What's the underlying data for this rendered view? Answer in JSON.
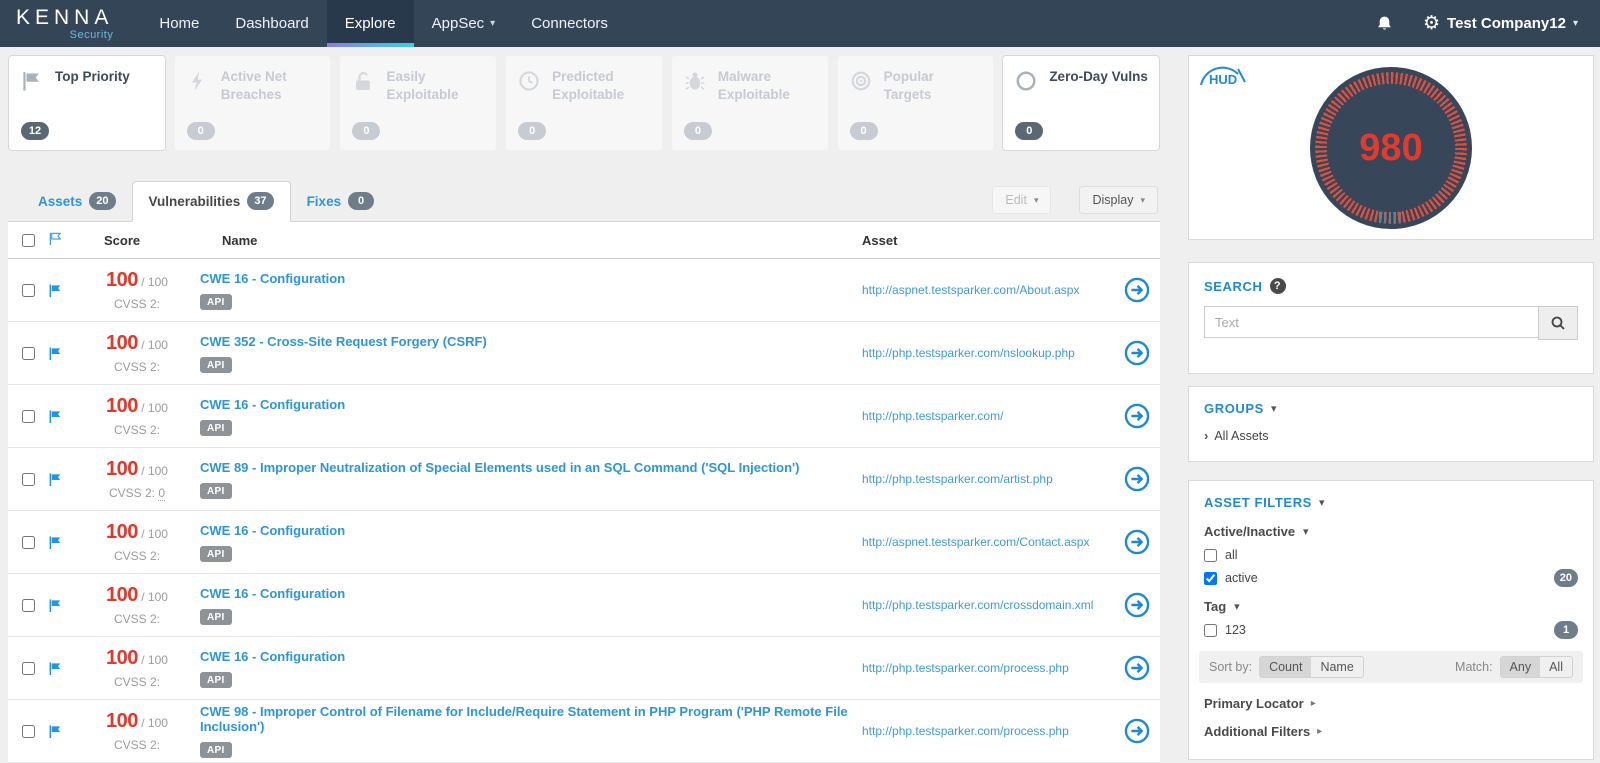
{
  "nav": {
    "brand_title": "KENNA",
    "brand_subtitle": "Security",
    "items": [
      {
        "label": "Home",
        "active": false
      },
      {
        "label": "Dashboard",
        "active": false
      },
      {
        "label": "Explore",
        "active": true
      },
      {
        "label": "AppSec",
        "active": false,
        "dropdown": true
      },
      {
        "label": "Connectors",
        "active": false
      }
    ],
    "account_label": "Test Company12"
  },
  "risk_meters": [
    {
      "label": "Top Priority",
      "count": "12",
      "icon": "flag-icon",
      "active": true
    },
    {
      "label": "Active Net Breaches",
      "count": "0",
      "icon": "bolt-icon",
      "active": false
    },
    {
      "label": "Easily Exploitable",
      "count": "0",
      "icon": "unlock-icon",
      "active": false
    },
    {
      "label": "Predicted Exploitable",
      "count": "0",
      "icon": "clock-icon",
      "active": false
    },
    {
      "label": "Malware Exploitable",
      "count": "0",
      "icon": "bug-icon",
      "active": false
    },
    {
      "label": "Popular Targets",
      "count": "0",
      "icon": "target-icon",
      "active": false
    },
    {
      "label": "Zero-Day Vulns",
      "count": "0",
      "icon": "circle-icon",
      "active": true
    }
  ],
  "tabs": [
    {
      "label": "Assets",
      "count": "20",
      "active": false
    },
    {
      "label": "Vulnerabilities",
      "count": "37",
      "active": true
    },
    {
      "label": "Fixes",
      "count": "0",
      "active": false
    }
  ],
  "toolbar": {
    "edit_label": "Edit",
    "display_label": "Display"
  },
  "table": {
    "headers": {
      "score": "Score",
      "name": "Name",
      "asset": "Asset"
    },
    "rows": [
      {
        "score": "100",
        "score_max": "/ 100",
        "cvss_label": "CVSS 2:",
        "cvss_value": "",
        "name": "CWE 16 - Configuration",
        "badge": "API",
        "asset": "http://aspnet.testsparker.com/About.aspx"
      },
      {
        "score": "100",
        "score_max": "/ 100",
        "cvss_label": "CVSS 2:",
        "cvss_value": "",
        "name": "CWE 352 - Cross-Site Request Forgery (CSRF)",
        "badge": "API",
        "asset": "http://php.testsparker.com/nslookup.php"
      },
      {
        "score": "100",
        "score_max": "/ 100",
        "cvss_label": "CVSS 2:",
        "cvss_value": "",
        "name": "CWE 16 - Configuration",
        "badge": "API",
        "asset": "http://php.testsparker.com/"
      },
      {
        "score": "100",
        "score_max": "/ 100",
        "cvss_label": "CVSS 2:",
        "cvss_value": "0",
        "name": "CWE 89 - Improper Neutralization of Special Elements used in an SQL Command ('SQL Injection')",
        "badge": "API",
        "asset": "http://php.testsparker.com/artist.php"
      },
      {
        "score": "100",
        "score_max": "/ 100",
        "cvss_label": "CVSS 2:",
        "cvss_value": "",
        "name": "CWE 16 - Configuration",
        "badge": "API",
        "asset": "http://aspnet.testsparker.com/Contact.aspx"
      },
      {
        "score": "100",
        "score_max": "/ 100",
        "cvss_label": "CVSS 2:",
        "cvss_value": "",
        "name": "CWE 16 - Configuration",
        "badge": "API",
        "asset": "http://php.testsparker.com/crossdomain.xml"
      },
      {
        "score": "100",
        "score_max": "/ 100",
        "cvss_label": "CVSS 2:",
        "cvss_value": "",
        "name": "CWE 16 - Configuration",
        "badge": "API",
        "asset": "http://php.testsparker.com/process.php"
      },
      {
        "score": "100",
        "score_max": "/ 100",
        "cvss_label": "CVSS 2:",
        "cvss_value": "",
        "name": "CWE 98 - Improper Control of Filename for Include/Require Statement in PHP Program ('PHP Remote File Inclusion')",
        "badge": "API",
        "asset": "http://php.testsparker.com/process.php"
      }
    ]
  },
  "hud": {
    "logo": "HUD",
    "risk_score": "980"
  },
  "search_panel": {
    "heading": "SEARCH",
    "placeholder": "Text"
  },
  "groups_panel": {
    "heading": "GROUPS",
    "item": "All Assets"
  },
  "filters_panel": {
    "heading": "ASSET FILTERS",
    "active_inactive": {
      "label": "Active/Inactive",
      "options": [
        {
          "label": "all",
          "checked": false,
          "count": ""
        },
        {
          "label": "active",
          "checked": true,
          "count": "20"
        }
      ]
    },
    "tag": {
      "label": "Tag",
      "options": [
        {
          "label": "123",
          "checked": false,
          "count": "1"
        }
      ]
    },
    "sort": {
      "label": "Sort by:",
      "options": [
        {
          "label": "Count",
          "selected": true
        },
        {
          "label": "Name",
          "selected": false
        }
      ]
    },
    "match": {
      "label": "Match:",
      "options": [
        {
          "label": "Any",
          "selected": true
        },
        {
          "label": "All",
          "selected": false
        }
      ]
    },
    "primary_locator": "Primary Locator",
    "additional_filters": "Additional Filters"
  },
  "colors": {
    "accent_blue": "#2d95d8",
    "score_red": "#e0392c",
    "nav_bg": "#344558",
    "nav_active_underline": "linear purple-to-cyan",
    "gauge_bg": "#374659",
    "gauge_tick_red": "#e0503e"
  }
}
